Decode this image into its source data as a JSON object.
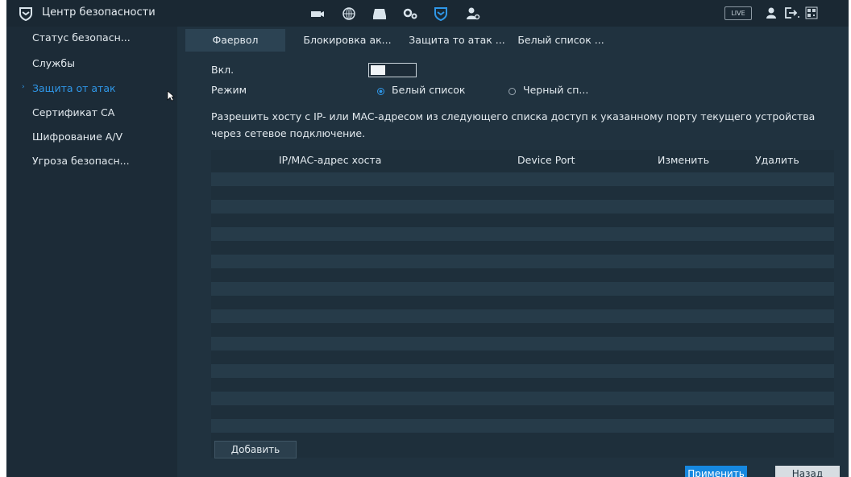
{
  "app": {
    "title": "Центр безопасности",
    "live_label": "LIVE",
    "accent_color": "#2f97e8"
  },
  "topnav": {
    "icons": [
      "camera-icon",
      "network-icon",
      "storage-icon",
      "settings-icon",
      "security-shield-icon",
      "account-icon"
    ],
    "right_icons": [
      "user-icon",
      "logout-icon",
      "qr-icon"
    ]
  },
  "sidebar": {
    "items": [
      {
        "label": "Статус безопасн..."
      },
      {
        "label": "Службы"
      },
      {
        "label": "Защита от атак"
      },
      {
        "label": "Сертификат CA"
      },
      {
        "label": "Шифрование A/V"
      },
      {
        "label": "Угроза безопасн..."
      }
    ]
  },
  "tabs": [
    {
      "label": "Фаервол"
    },
    {
      "label": "Блокировка ак..."
    },
    {
      "label": "Защита то атак ..."
    },
    {
      "label": "Белый список ..."
    }
  ],
  "form": {
    "enable_label": "Вкл.",
    "mode_label": "Режим",
    "mode_options": [
      "Белый список",
      "Черный сп..."
    ],
    "description": "Разрешить хосту с IP- или MAC-адресом из следующего списка доступ к указанному порту текущего устройства через сетевое подключение."
  },
  "table": {
    "columns": [
      "IP/MAC-адрес хоста",
      "Device Port",
      "Изменить",
      "Удалить"
    ],
    "rows": []
  },
  "buttons": {
    "add": "Добавить",
    "apply": "Применить",
    "back": "Назад"
  }
}
